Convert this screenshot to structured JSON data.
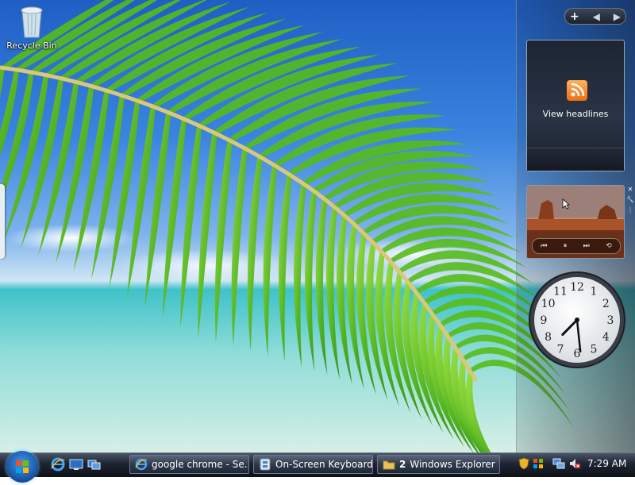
{
  "desktop": {
    "icons": [
      {
        "label": "Recycle Bin",
        "icon": "recycle-bin-icon"
      }
    ]
  },
  "sidebar": {
    "controls": {
      "add": "+",
      "prev": "◀",
      "next": "▶"
    },
    "feed_gadget": {
      "label": "View headlines",
      "icon": "rss-feed-icon"
    },
    "slideshow_gadget": {
      "controls": [
        "⏮",
        "⏸",
        "⏭",
        "⟲"
      ]
    },
    "clock_gadget": {
      "numerals": [
        "12",
        "1",
        "2",
        "3",
        "4",
        "5",
        "6",
        "7",
        "8",
        "9",
        "10",
        "11"
      ],
      "hour": 7,
      "minute": 29
    }
  },
  "taskbar": {
    "quick_launch": [
      "internet-explorer-icon",
      "show-desktop-icon",
      "switch-windows-icon"
    ],
    "buttons": [
      {
        "label": "google chrome - Se...",
        "icon": "internet-explorer-icon"
      },
      {
        "label": "On-Screen Keyboard",
        "icon": "keyboard-icon"
      },
      {
        "count": "2",
        "label": "Windows Explorer",
        "icon": "folder-icon",
        "arrow": "▼"
      }
    ],
    "tray": {
      "icons": [
        "security-shield-icon",
        "windows-update-icon",
        "network-icon",
        "volume-muted-icon"
      ],
      "time": "7:29 AM"
    }
  },
  "colors": {
    "taskbar": "#1d2330",
    "sky": "#1f5fc4",
    "sea": "#3fc2c9",
    "palm": "#5fbf1e"
  }
}
